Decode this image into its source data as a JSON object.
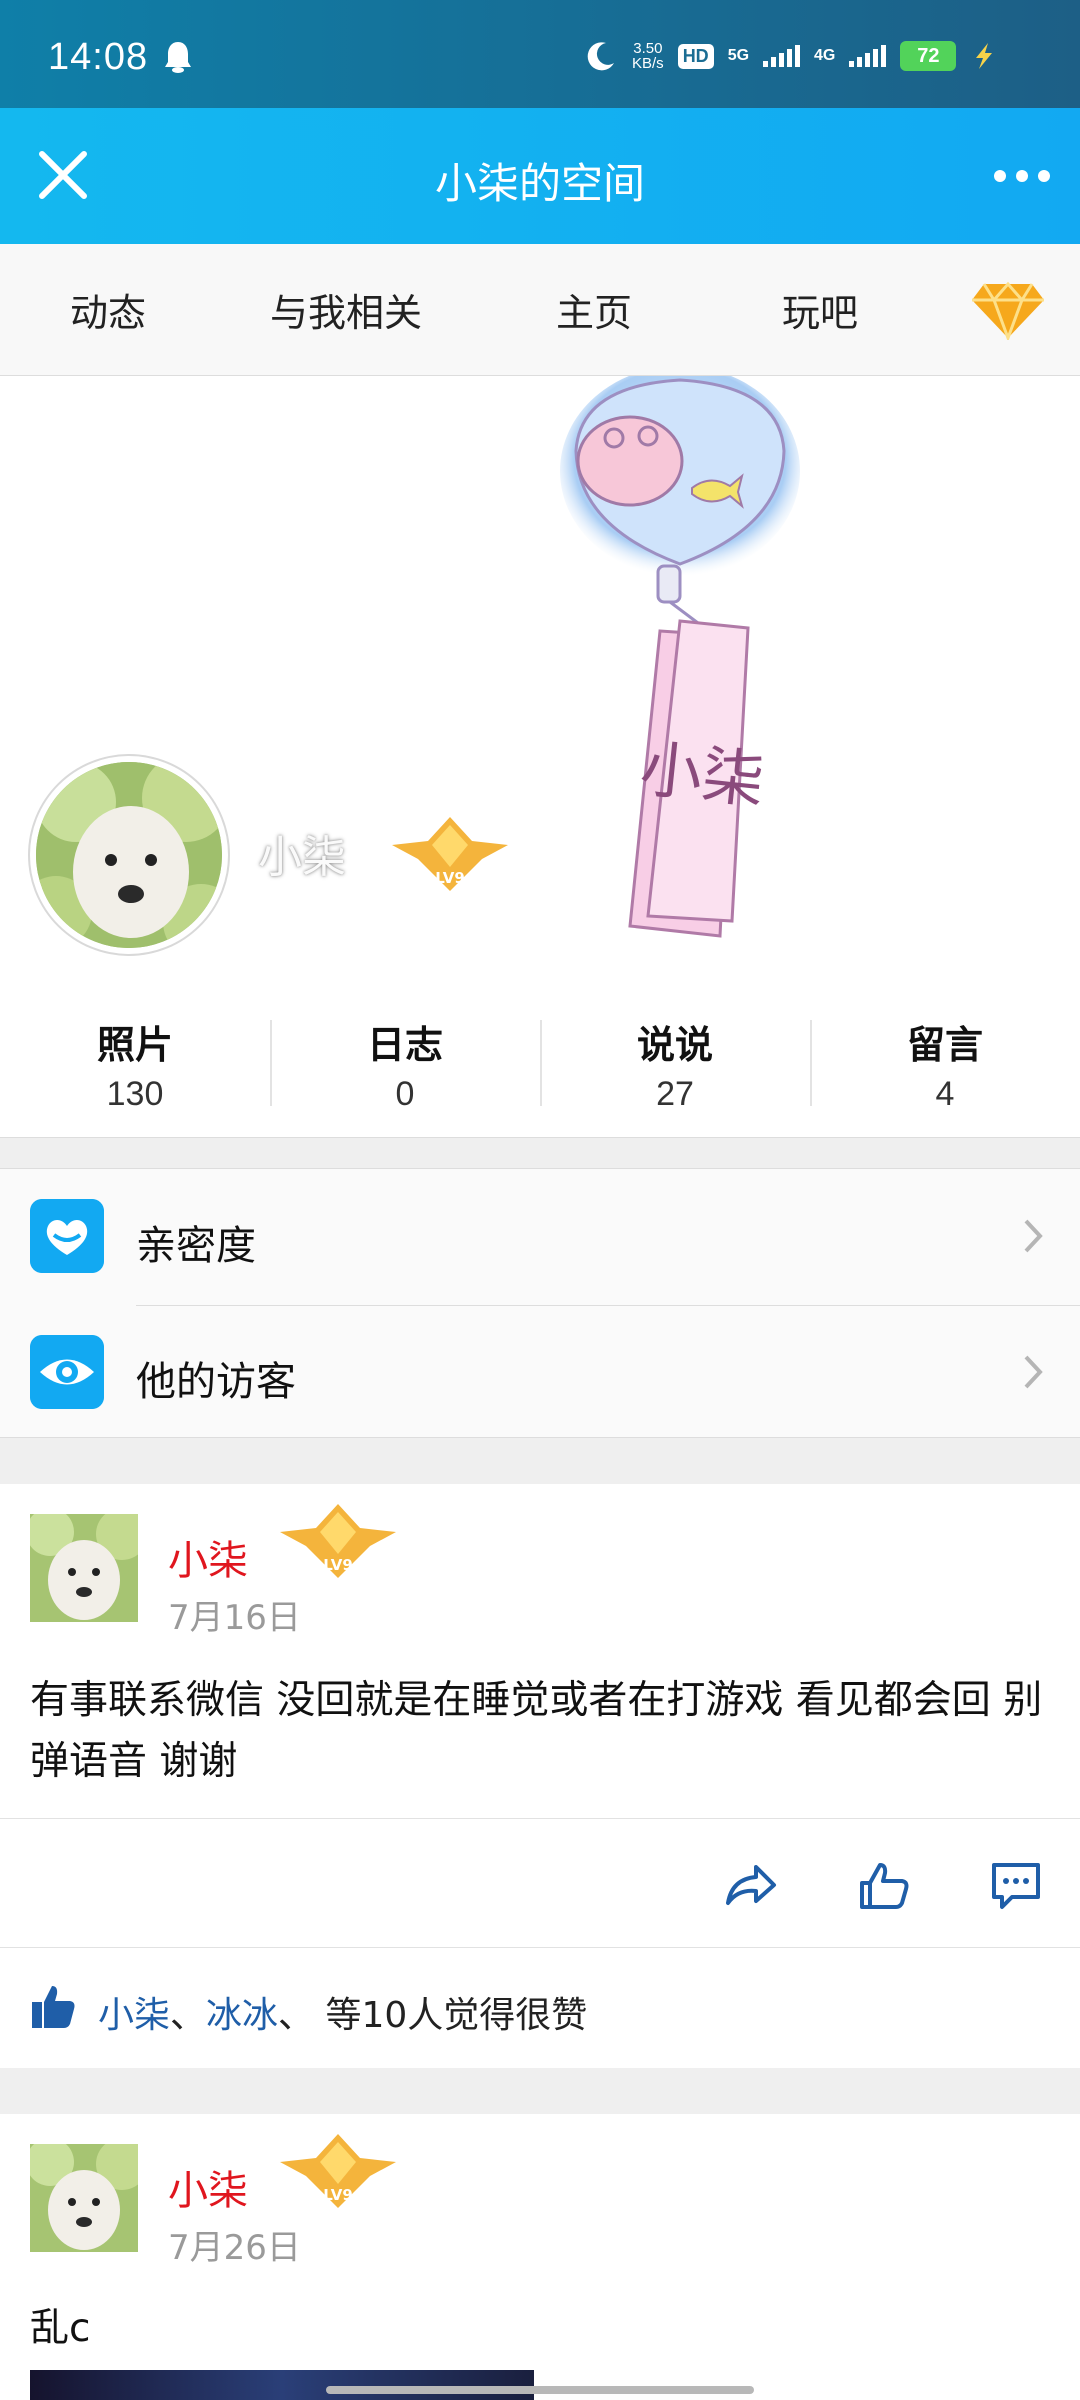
{
  "status_bar": {
    "time": "14:08",
    "speed_top": "3.50",
    "speed_bottom": "KB/s",
    "hd_label": "HD",
    "net1": "5G",
    "net2": "4G",
    "battery": "72"
  },
  "header": {
    "title": "小柒的空间"
  },
  "tabs": [
    "动态",
    "与我相关",
    "主页",
    "玩吧"
  ],
  "profile": {
    "name": "小柒",
    "level": "LV9",
    "cover_tag": "小柒"
  },
  "stats": [
    {
      "label": "照片",
      "value": "130"
    },
    {
      "label": "日志",
      "value": "0"
    },
    {
      "label": "说说",
      "value": "27"
    },
    {
      "label": "留言",
      "value": "4"
    }
  ],
  "menu": [
    {
      "label": "亲密度",
      "icon": "heart-icon"
    },
    {
      "label": "他的访客",
      "icon": "eye-icon"
    }
  ],
  "posts": [
    {
      "author": "小柒",
      "level": "LV9",
      "date": "7月16日",
      "text": "有事联系微信 没回就是在睡觉或者在打游戏 看见都会回 别弹语音 谢谢",
      "likes": {
        "user1": "小柒",
        "sep1": "、",
        "user2": "冰冰",
        "rest": "、 等10人觉得很赞"
      }
    },
    {
      "author": "小柒",
      "level": "LV9",
      "date": "7月26日",
      "text": "乱c"
    }
  ],
  "colors": {
    "accent": "#12a9f2",
    "author": "#e0161e",
    "link": "#1f5ea8"
  }
}
